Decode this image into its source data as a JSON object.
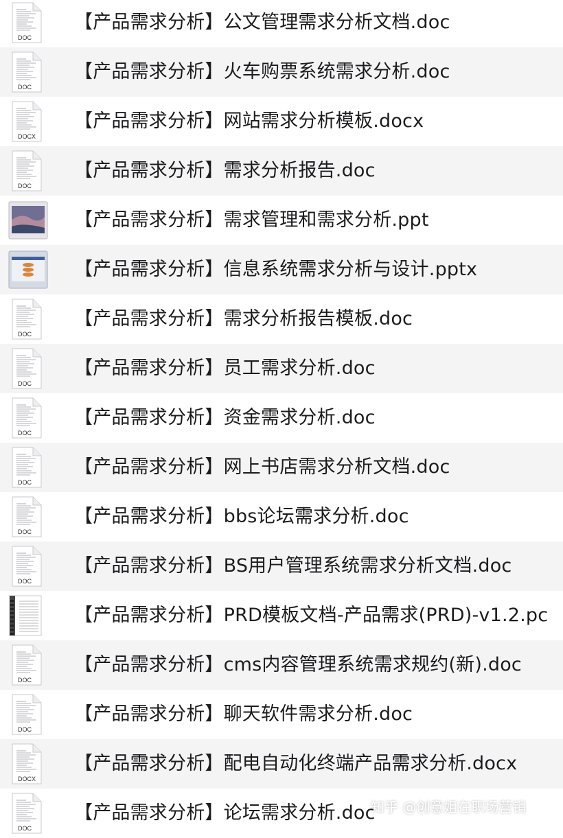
{
  "files": [
    {
      "name": "【产品需求分析】公文管理需求分析文档.doc",
      "icon": "doc-file-icon",
      "ext": "DOC"
    },
    {
      "name": "【产品需求分析】火车购票系统需求分析.doc",
      "icon": "doc-file-icon",
      "ext": "DOC"
    },
    {
      "name": "【产品需求分析】网站需求分析模板.docx",
      "icon": "docx-file-icon",
      "ext": "DOCX"
    },
    {
      "name": "【产品需求分析】需求分析报告.doc",
      "icon": "doc-file-icon",
      "ext": "DOC"
    },
    {
      "name": "【产品需求分析】需求管理和需求分析.ppt",
      "icon": "ppt-thumbnail-icon",
      "ext": ""
    },
    {
      "name": "【产品需求分析】信息系统需求分析与设计.pptx",
      "icon": "pptx-thumbnail-icon",
      "ext": ""
    },
    {
      "name": "【产品需求分析】需求分析报告模板.doc",
      "icon": "doc-file-icon",
      "ext": "DOC"
    },
    {
      "name": "【产品需求分析】员工需求分析.doc",
      "icon": "doc-file-icon",
      "ext": "DOC"
    },
    {
      "name": "【产品需求分析】资金需求分析.doc",
      "icon": "doc-file-icon",
      "ext": "DOC"
    },
    {
      "name": "【产品需求分析】网上书店需求分析文档.doc",
      "icon": "doc-file-icon",
      "ext": "DOC"
    },
    {
      "name": "【产品需求分析】bbs论坛需求分析.doc",
      "icon": "doc-file-icon",
      "ext": "DOC"
    },
    {
      "name": "【产品需求分析】BS用户管理系统需求分析文档.doc",
      "icon": "doc-file-icon",
      "ext": "DOC"
    },
    {
      "name": "【产品需求分析】PRD模板文档-产品需求(PRD)-v1.2.pc",
      "icon": "pdf-thumbnail-icon",
      "ext": ""
    },
    {
      "name": "【产品需求分析】cms内容管理系统需求规约(新).doc",
      "icon": "doc-file-icon",
      "ext": "DOC"
    },
    {
      "name": "【产品需求分析】聊天软件需求分析.doc",
      "icon": "doc-file-icon",
      "ext": "DOC"
    },
    {
      "name": "【产品需求分析】配电自动化终端产品需求分析.docx",
      "icon": "docx-file-icon",
      "ext": "DOCX"
    },
    {
      "name": "【产品需求分析】论坛需求分析.doc",
      "icon": "doc-file-icon",
      "ext": "DOC"
    }
  ],
  "watermark": "知乎 @创意姐在职场营销"
}
